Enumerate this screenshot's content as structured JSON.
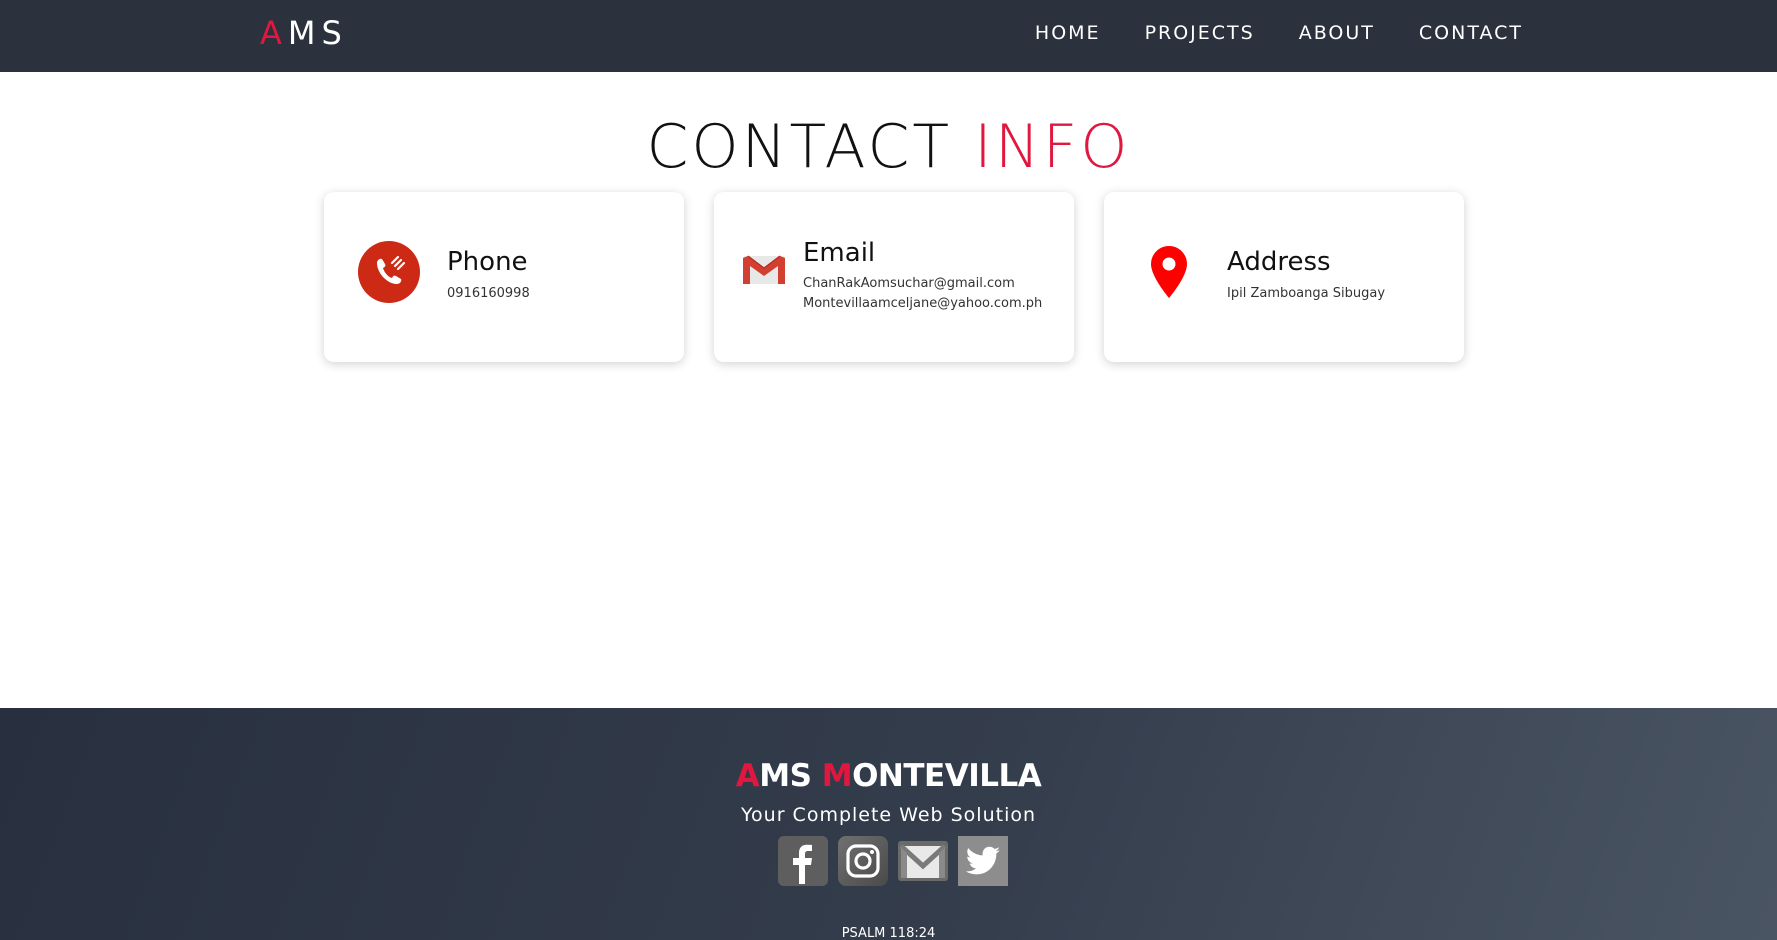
{
  "nav": {
    "logo": {
      "first": "A",
      "rest": "MS"
    },
    "items": [
      {
        "label": "HOME"
      },
      {
        "label": "PROJECTS"
      },
      {
        "label": "ABOUT"
      },
      {
        "label": "CONTACT"
      }
    ]
  },
  "heading": {
    "main": "CONTACT",
    "accent": "INFO"
  },
  "cards": {
    "phone": {
      "title": "Phone",
      "lines": [
        "0916160998"
      ],
      "icon": "phone-icon"
    },
    "email": {
      "title": "Email",
      "lines": [
        "ChanRakAomsuchar@gmail.com",
        "Montevillaamceljane@yahoo.com.ph"
      ],
      "icon": "gmail-icon"
    },
    "address": {
      "title": "Address",
      "lines": [
        "Ipil Zamboanga Sibugay"
      ],
      "icon": "map-pin-icon"
    }
  },
  "footer": {
    "brand": {
      "a1": "A",
      "ms": "MS ",
      "m2": "M",
      "rest": "ONTEVILLA"
    },
    "tagline": "Your Complete Web Solution",
    "socials": [
      {
        "icon": "facebook-icon"
      },
      {
        "icon": "instagram-icon"
      },
      {
        "icon": "mail-icon"
      },
      {
        "icon": "twitter-icon"
      }
    ],
    "verse": "PSALM 118:24"
  },
  "colors": {
    "accent": "#e0173f",
    "nav_bg": "#2b313d",
    "footer_bg_start": "#283040",
    "footer_bg_end": "#4a5563",
    "phone_icon": "#cc2a14",
    "pin_icon": "#ff0000"
  }
}
